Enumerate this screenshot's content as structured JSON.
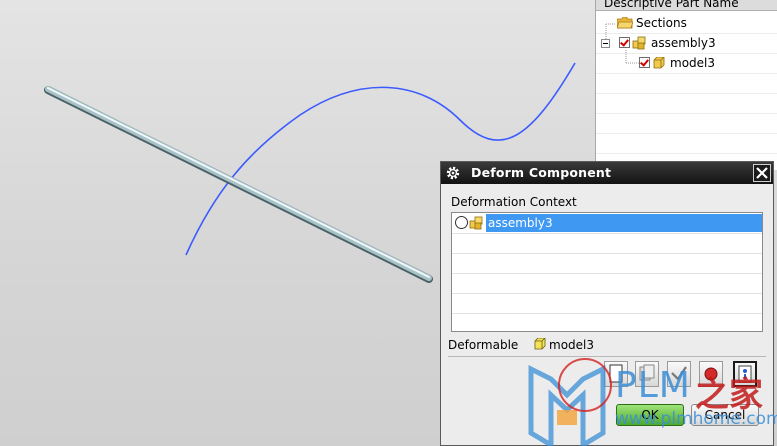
{
  "navigator": {
    "header": "Descriptive Part Name",
    "items": [
      {
        "label": "Sections"
      },
      {
        "label": "assembly3",
        "checked": true
      },
      {
        "label": "model3",
        "checked": true
      }
    ]
  },
  "dialog": {
    "title": "Deform Component",
    "context_label": "Deformation Context",
    "context_items": [
      {
        "label": "assembly3",
        "selected": true
      }
    ],
    "deformable_label": "Deformable",
    "deformable_value": "model3",
    "ok_label": "OK",
    "cancel_label": "Cancel"
  },
  "watermark": {
    "brand": "PLM",
    "cn": "之家",
    "url": "www.plmhome.com"
  },
  "colors": {
    "curve": "#3b5bff",
    "selection": "#3f98f2",
    "ok_button": "#5cb536",
    "checkbox_mark": "#d00000"
  }
}
